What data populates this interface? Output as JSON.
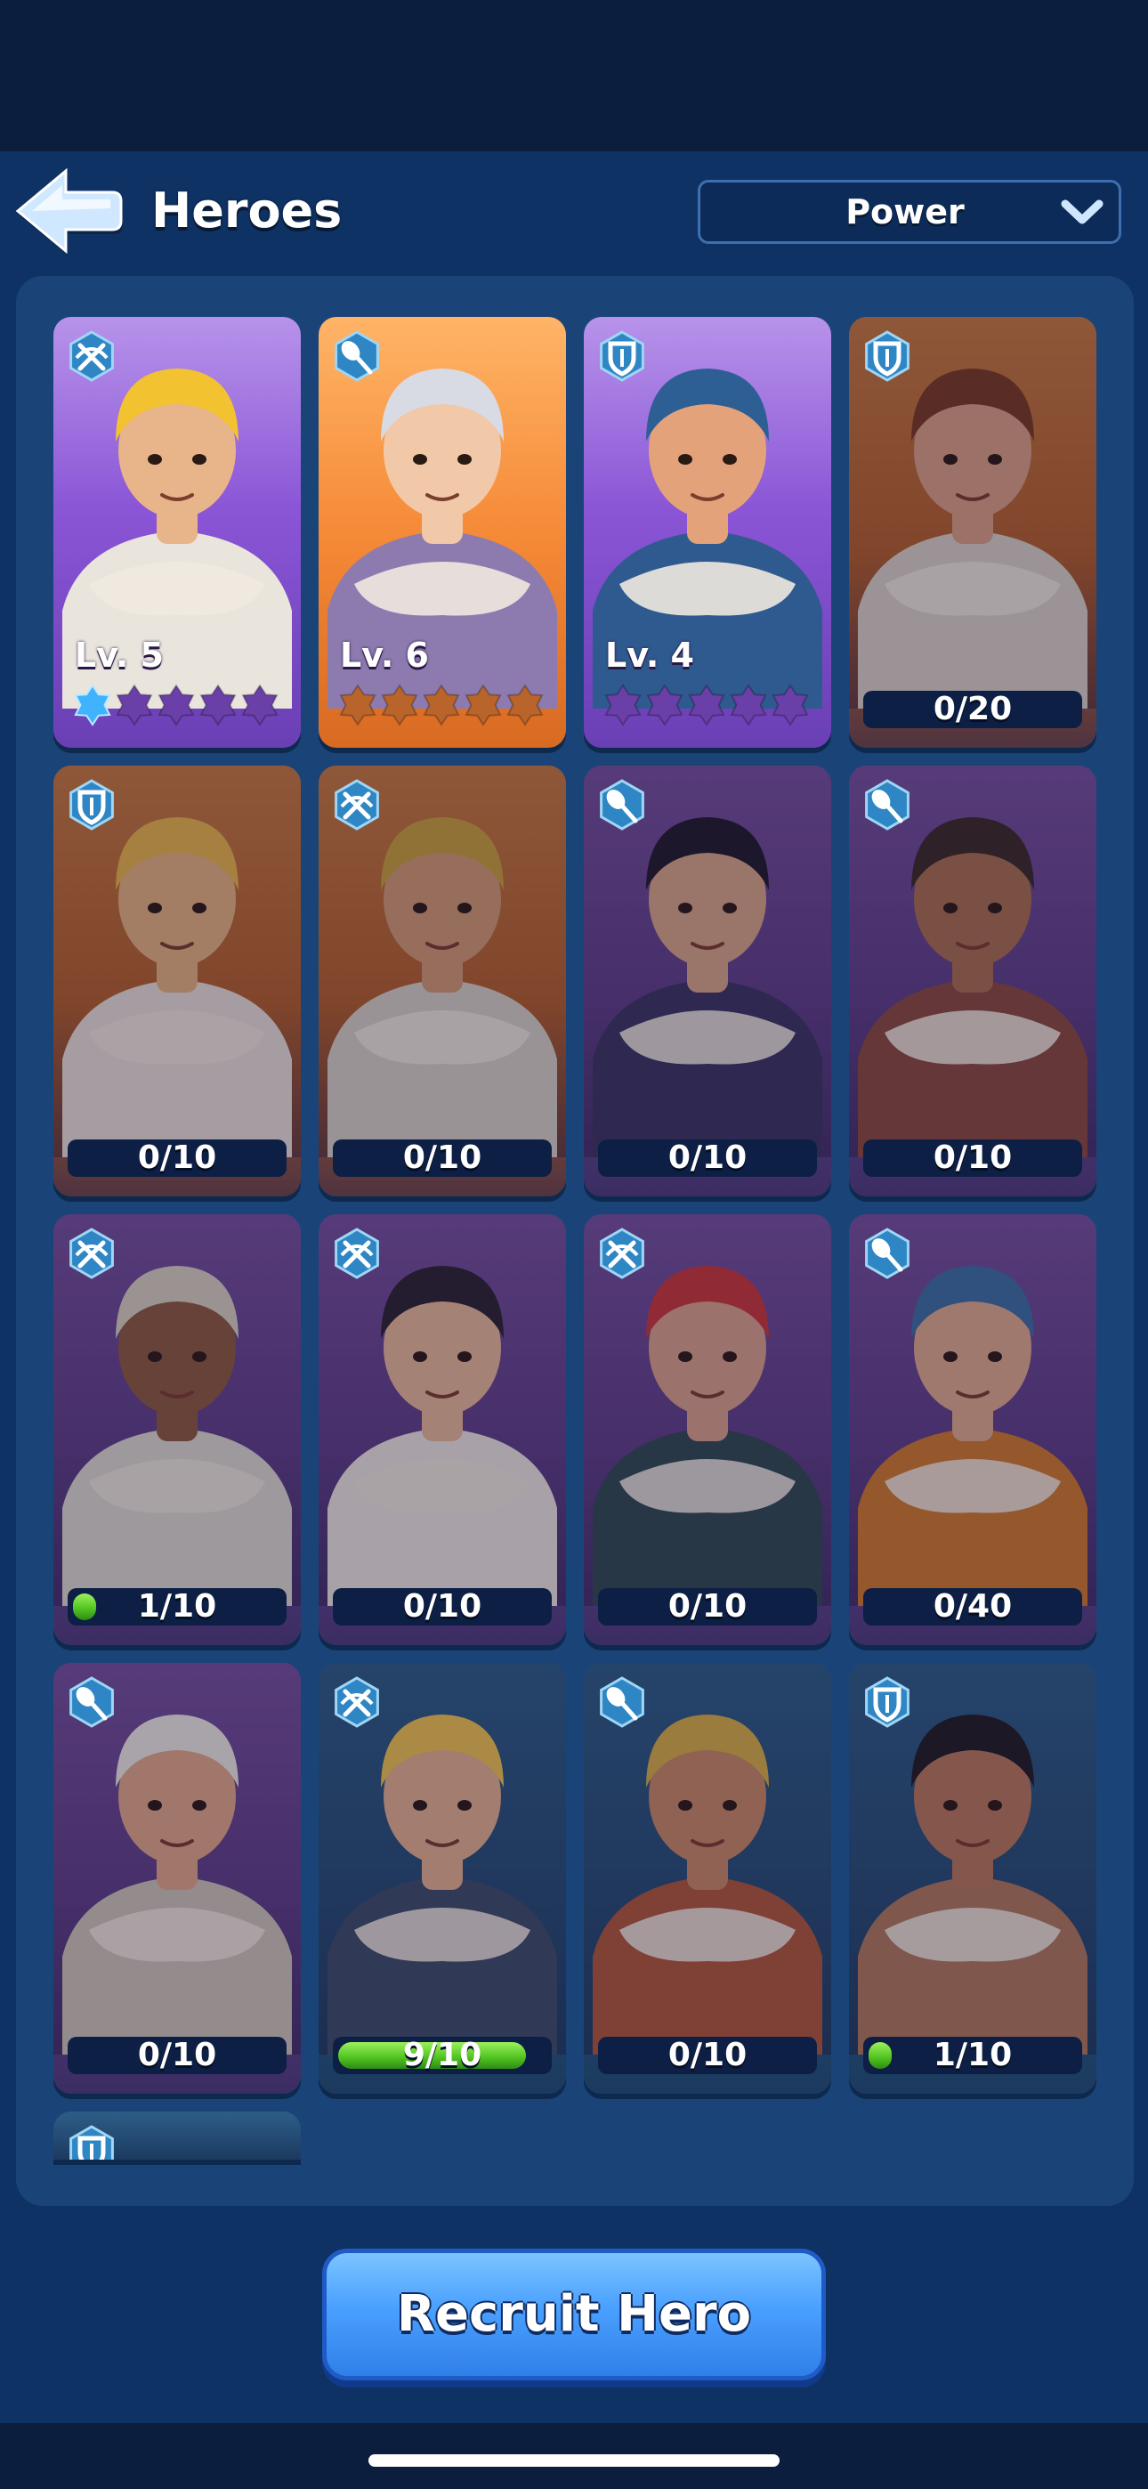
{
  "header": {
    "title": "Heroes",
    "back_icon": "back-arrow-icon",
    "sort": {
      "selected": "Power",
      "icon": "chevron-down-icon"
    }
  },
  "colors": {
    "background": "#0f3265",
    "panel": "#1a4477",
    "card_purple": "#8a55d6",
    "card_orange": "#f58a37",
    "progress_green": "#4ec11f",
    "button_blue": "#4aa0ff"
  },
  "heroes": [
    {
      "variant": "purple",
      "class_icon": "crossbow-icon",
      "owned": true,
      "level": "Lv. 5",
      "stars_filled": 1,
      "stars_total": 5,
      "skin": "#e8b48a",
      "hair": "#f2c230",
      "outfit": "#e9e4dc"
    },
    {
      "variant": "orange",
      "class_icon": "shovel-icon",
      "owned": true,
      "level": "Lv. 6",
      "stars_filled": 0,
      "stars_total": 5,
      "skin": "#f1c8a8",
      "hair": "#d8dbe4",
      "outfit": "#8d7bb0"
    },
    {
      "variant": "purple",
      "class_icon": "shield-icon",
      "owned": true,
      "level": "Lv. 4",
      "stars_filled": 0,
      "stars_total": 5,
      "skin": "#e3a27a",
      "hair": "#2e5f94",
      "outfit": "#2f5a8f"
    },
    {
      "variant": "locked-orange",
      "class_icon": "shield-icon",
      "owned": false,
      "progress": "0/20",
      "progress_fraction": 0,
      "skin": "#d9a083",
      "hair": "#7a3a22",
      "outfit": "#d9d2c6"
    },
    {
      "variant": "locked-orange",
      "class_icon": "shield-icon",
      "owned": false,
      "progress": "0/10",
      "progress_fraction": 0,
      "skin": "#e6b27f",
      "hair": "#e9b64a",
      "outfit": "#e7e1d8"
    },
    {
      "variant": "locked-orange",
      "class_icon": "crossbow-icon",
      "owned": false,
      "progress": "0/10",
      "progress_fraction": 0,
      "skin": "#d39a72",
      "hair": "#c9a13a",
      "outfit": "#d7d1c6"
    },
    {
      "variant": "locked-purple",
      "class_icon": "shovel-icon",
      "owned": false,
      "progress": "0/10",
      "progress_fraction": 0,
      "skin": "#d8a585",
      "hair": "#1f1b2c",
      "outfit": "#3a3563"
    },
    {
      "variant": "locked-purple",
      "class_icon": "shovel-icon",
      "owned": false,
      "progress": "0/10",
      "progress_fraction": 0,
      "skin": "#a86e4e",
      "hair": "#3a2a26",
      "outfit": "#8a4a3d"
    },
    {
      "variant": "locked-purple",
      "class_icon": "crossbow-icon",
      "owned": false,
      "progress": "1/10",
      "progress_fraction": 0.1,
      "skin": "#8d5a3e",
      "hair": "#d9d2c0",
      "outfit": "#dedad2"
    },
    {
      "variant": "locked-purple",
      "class_icon": "crossbow-icon",
      "owned": false,
      "progress": "0/10",
      "progress_fraction": 0,
      "skin": "#e7b898",
      "hair": "#2a2230",
      "outfit": "#ece8e2"
    },
    {
      "variant": "locked-purple",
      "class_icon": "crossbow-icon",
      "owned": false,
      "progress": "0/10",
      "progress_fraction": 0,
      "skin": "#d9a18a",
      "hair": "#c9383a",
      "outfit": "#2f4a52"
    },
    {
      "variant": "locked-purple",
      "class_icon": "shovel-icon",
      "owned": false,
      "progress": "0/40",
      "progress_fraction": 0,
      "skin": "#e1ab8c",
      "hair": "#3b6fa2",
      "outfit": "#d07a2c"
    },
    {
      "variant": "locked-purple",
      "class_icon": "shovel-icon",
      "owned": false,
      "progress": "0/10",
      "progress_fraction": 0,
      "skin": "#e2a98a",
      "hair": "#eeeae4",
      "outfit": "#cfc6b8"
    },
    {
      "variant": "locked-blue",
      "class_icon": "crossbow-icon",
      "owned": false,
      "progress": "9/10",
      "progress_fraction": 0.9,
      "skin": "#e3b190",
      "hair": "#f0c450",
      "outfit": "#3b4e6a"
    },
    {
      "variant": "locked-blue",
      "class_icon": "shovel-icon",
      "owned": false,
      "progress": "0/10",
      "progress_fraction": 0,
      "skin": "#c98a66",
      "hair": "#d6b046",
      "outfit": "#b0583a"
    },
    {
      "variant": "locked-blue",
      "class_icon": "shield-icon",
      "owned": false,
      "progress": "1/10",
      "progress_fraction": 0.1,
      "skin": "#b87a5a",
      "hair": "#1e1c22",
      "outfit": "#b07a5a"
    },
    {
      "variant": "locked-blue",
      "class_icon": "shield-icon",
      "owned": false,
      "partial": true
    }
  ],
  "recruit_button": {
    "label": "Recruit Hero"
  }
}
